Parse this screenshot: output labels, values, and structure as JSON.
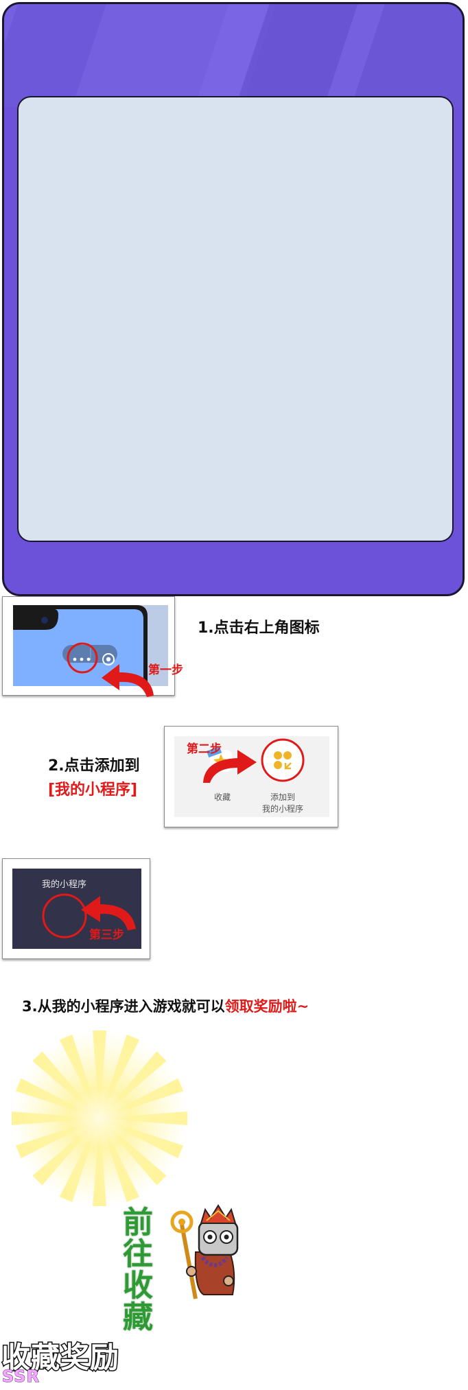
{
  "colors": {
    "card_purple": "#6c52d8",
    "card_inner": "#d9e2ef",
    "accent_red": "#e01919",
    "button_green": "#2d9a33",
    "badge_pink": "#f3a9ff"
  },
  "steps": {
    "step1": {
      "instruction": "1.点击右上角图标",
      "tag": "第一步",
      "icons": [
        "more-dots-icon",
        "record-target-icon"
      ]
    },
    "step2": {
      "instruction_line1": "2.点击添加到",
      "instruction_line2": "[我的小程序]",
      "tag": "第二步",
      "favorite_label": "收藏",
      "add_label_line1": "添加到",
      "add_label_line2": "我的小程序"
    },
    "step3": {
      "screen_label": "我的小程序",
      "tag": "第三步",
      "instruction_prefix": "3.从我的小程序进入游戏就可以",
      "instruction_highlight": "领取奖励啦~"
    }
  },
  "reward": {
    "go_favorite_label": "前往收藏",
    "title": "收藏奖励",
    "rarity": "SSR",
    "character": "monk-character-with-golden-staff"
  }
}
